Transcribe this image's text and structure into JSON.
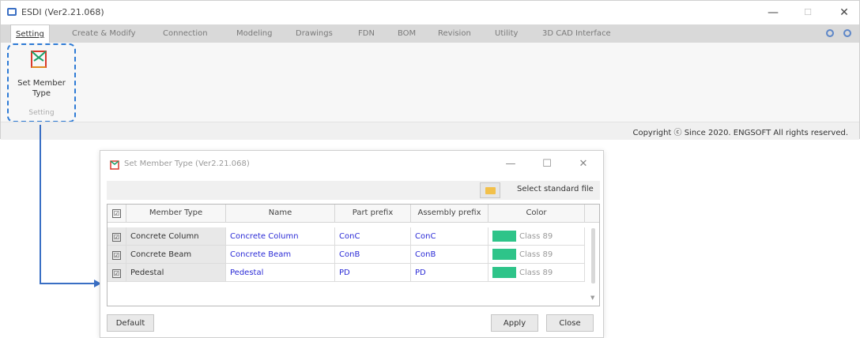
{
  "app": {
    "title": "ESDI (Ver2.21.068)",
    "minimize": "—",
    "maximize": "☐",
    "close": "✕"
  },
  "menu": {
    "items": [
      "Setting",
      "Create & Modify",
      "Connection",
      "Modeling",
      "Drawings",
      "FDN",
      "BOM",
      "Revision",
      "Utility",
      "3D CAD Interface"
    ]
  },
  "ribbon": {
    "button_label_1": "Set Member",
    "button_label_2": "Type",
    "group_label": "Setting"
  },
  "status": {
    "copyright": "Copyright ⓒ Since 2020. ENGSOFT All rights reserved."
  },
  "dialog": {
    "title": "Set Member Type (Ver2.21.068)",
    "minimize": "—",
    "maximize": "☐",
    "close": "✕",
    "select_standard_file": "Select standard file",
    "columns": [
      "Member Type",
      "Name",
      "Part prefix",
      "Assembly prefix",
      "Color"
    ],
    "rows": [
      {
        "member_type": "Concrete Column",
        "name": "Concrete Column",
        "part_prefix": "ConC",
        "assembly_prefix": "ConC",
        "color_class": "Class 89",
        "checked": "☑"
      },
      {
        "member_type": "Concrete Beam",
        "name": "Concrete Beam",
        "part_prefix": "ConB",
        "assembly_prefix": "ConB",
        "color_class": "Class 89",
        "checked": "☑"
      },
      {
        "member_type": "Pedestal",
        "name": "Pedestal",
        "part_prefix": "PD",
        "assembly_prefix": "PD",
        "color_class": "Class 89",
        "checked": "☑"
      }
    ],
    "header_check": "☑",
    "swatch_color": "#2ec489",
    "buttons": {
      "default": "Default",
      "apply": "Apply",
      "close": "Close"
    }
  },
  "colors": {
    "accent": "#3a6fc4",
    "highlight_border": "#2e7bd6",
    "link_text": "#2b2bd6"
  }
}
